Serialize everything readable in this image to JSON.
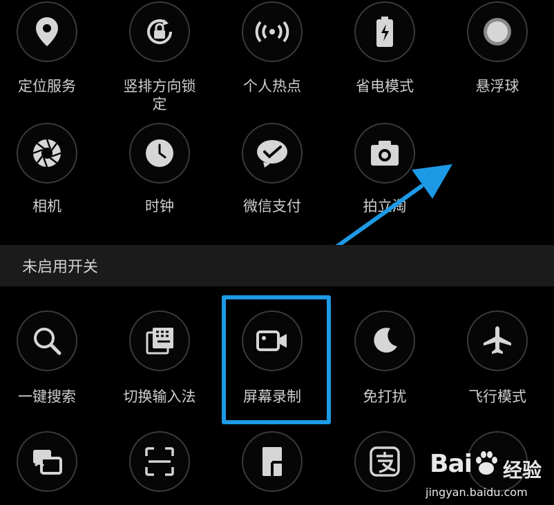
{
  "section": {
    "title": "未启用开关"
  },
  "enabled_tiles": [
    {
      "label": "定位服务",
      "icon": "location-pin-icon"
    },
    {
      "label": "竖排方向锁\n定",
      "icon": "rotation-lock-icon"
    },
    {
      "label": "个人热点",
      "icon": "hotspot-icon"
    },
    {
      "label": "省电模式",
      "icon": "battery-saver-icon"
    },
    {
      "label": "悬浮球",
      "icon": "floating-ball-icon"
    },
    {
      "label": "相机",
      "icon": "camera-shutter-icon"
    },
    {
      "label": "时钟",
      "icon": "clock-icon"
    },
    {
      "label": "微信支付",
      "icon": "wechat-pay-icon"
    },
    {
      "label": "拍立淘",
      "icon": "photo-camera-icon"
    }
  ],
  "disabled_tiles": [
    {
      "label": "一键搜索",
      "icon": "search-icon"
    },
    {
      "label": "切换输入法",
      "icon": "keyboard-switch-icon"
    },
    {
      "label": "屏幕录制",
      "icon": "screen-record-icon"
    },
    {
      "label": "免打扰",
      "icon": "moon-icon"
    },
    {
      "label": "飞行模式",
      "icon": "airplane-icon"
    },
    {
      "label": "",
      "icon": "cards-icon"
    },
    {
      "label": "",
      "icon": "scan-icon"
    },
    {
      "label": "",
      "icon": "document-icon"
    },
    {
      "label": "",
      "icon": "alipay-icon"
    }
  ],
  "watermark": {
    "brand": "Bai",
    "suffix": "经验",
    "url": "jingyan.baidu.com"
  },
  "colors": {
    "highlight": "#1d9ae6",
    "arrow": "#1d9ae6",
    "icon": "#d6d6d6"
  }
}
